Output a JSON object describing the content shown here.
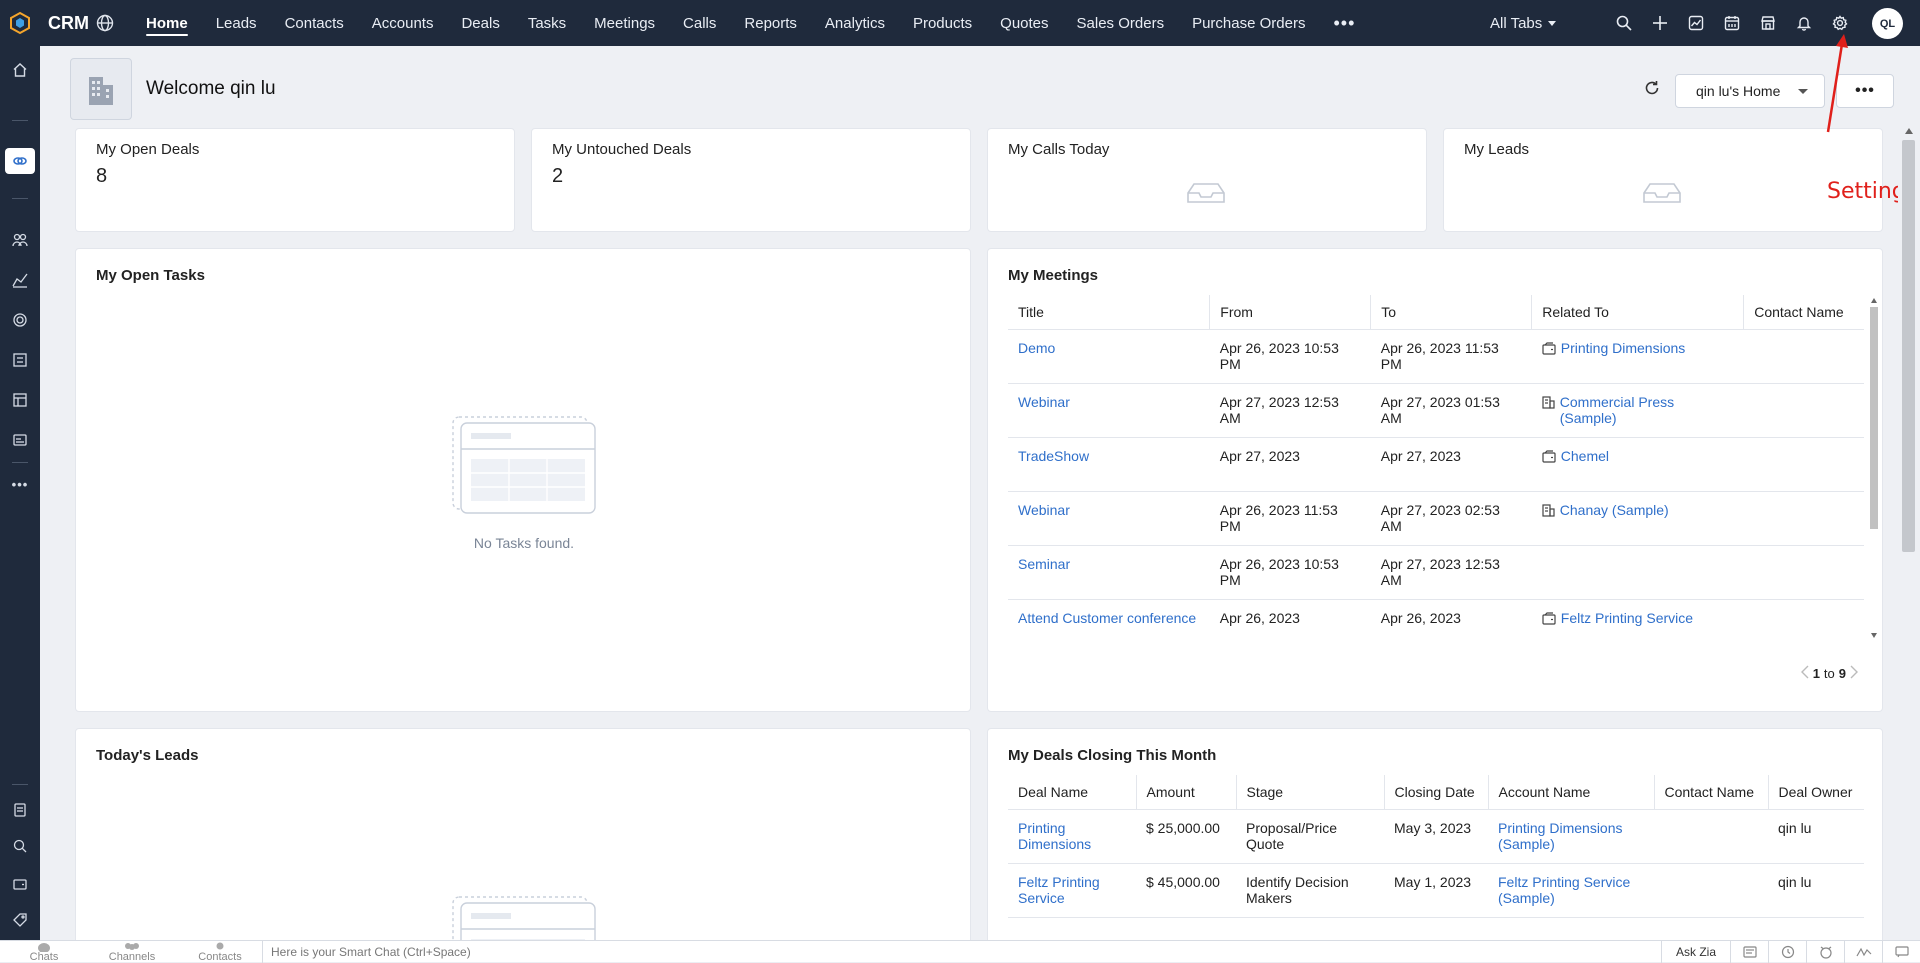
{
  "app": {
    "brand": "CRM"
  },
  "nav": {
    "items": [
      {
        "label": "Home",
        "active": true
      },
      {
        "label": "Leads"
      },
      {
        "label": "Contacts"
      },
      {
        "label": "Accounts"
      },
      {
        "label": "Deals"
      },
      {
        "label": "Tasks"
      },
      {
        "label": "Meetings"
      },
      {
        "label": "Calls"
      },
      {
        "label": "Reports"
      },
      {
        "label": "Analytics"
      },
      {
        "label": "Products"
      },
      {
        "label": "Quotes"
      },
      {
        "label": "Sales Orders"
      },
      {
        "label": "Purchase Orders"
      }
    ],
    "more": "•••",
    "all_tabs": "All Tabs"
  },
  "user": {
    "initials": "QL"
  },
  "header": {
    "welcome": "Welcome qin lu",
    "home_selector": "qin lu's Home",
    "more": "•••"
  },
  "kpis": [
    {
      "title": "My Open Deals",
      "value": "8"
    },
    {
      "title": "My Untouched Deals",
      "value": "2"
    },
    {
      "title": "My Calls Today",
      "value": ""
    },
    {
      "title": "My Leads",
      "value": ""
    }
  ],
  "open_tasks": {
    "title": "My Open Tasks",
    "empty": "No Tasks found."
  },
  "meetings": {
    "title": "My Meetings",
    "columns": [
      "Title",
      "From",
      "To",
      "Related To",
      "Contact Name"
    ],
    "rows": [
      {
        "title": "Demo",
        "from": "Apr 26, 2023 10:53 PM",
        "to": "Apr 26, 2023 11:53 PM",
        "related": "Printing Dimensions",
        "icon": "deal",
        "contact": ""
      },
      {
        "title": "Webinar",
        "from": "Apr 27, 2023 12:53 AM",
        "to": "Apr 27, 2023 01:53 AM",
        "related": "Commercial Press (Sample)",
        "icon": "account",
        "contact": ""
      },
      {
        "title": "TradeShow",
        "from": "Apr 27, 2023",
        "to": "Apr 27, 2023",
        "related": "Chemel",
        "icon": "deal",
        "contact": ""
      },
      {
        "title": "Webinar",
        "from": "Apr 26, 2023 11:53 PM",
        "to": "Apr 27, 2023 02:53 AM",
        "related": "Chanay (Sample)",
        "icon": "account",
        "contact": ""
      },
      {
        "title": "Seminar",
        "from": "Apr 26, 2023 10:53 PM",
        "to": "Apr 27, 2023 12:53 AM",
        "related": "",
        "icon": "",
        "contact": ""
      },
      {
        "title": "Attend Customer conference",
        "from": "Apr 26, 2023",
        "to": "Apr 26, 2023",
        "related": "Feltz Printing Service",
        "icon": "deal",
        "contact": ""
      }
    ],
    "pager": {
      "from": "1",
      "sep": "to",
      "to": "9"
    }
  },
  "todays_leads": {
    "title": "Today's Leads"
  },
  "deals_closing": {
    "title": "My Deals Closing This Month",
    "columns": [
      "Deal Name",
      "Amount",
      "Stage",
      "Closing Date",
      "Account Name",
      "Contact Name",
      "Deal Owner"
    ],
    "rows": [
      {
        "deal": "Printing Dimensions",
        "amount": "$ 25,000.00",
        "stage": "Proposal/Price Quote",
        "closing": "May 3, 2023",
        "account": "Printing Dimensions (Sample)",
        "contact": "",
        "owner": "qin lu"
      },
      {
        "deal": "Feltz Printing Service",
        "amount": "$ 45,000.00",
        "stage": "Identify Decision Makers",
        "closing": "May 1, 2023",
        "account": "Feltz Printing Service (Sample)",
        "contact": "",
        "owner": "qin lu"
      }
    ]
  },
  "bottom": {
    "items": [
      "Chats",
      "Channels",
      "Contacts"
    ],
    "smart_chat": "Here is your Smart Chat (Ctrl+Space)",
    "ask_zia": "Ask Zia"
  },
  "annotation": {
    "label": "Settings",
    "color": "#e0201b"
  }
}
